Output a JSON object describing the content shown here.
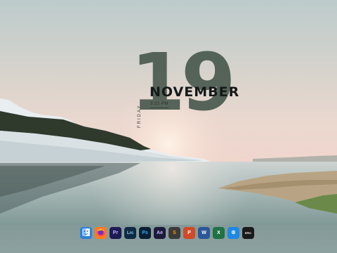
{
  "clock": {
    "day": "19",
    "month": "NOVEMBER",
    "time": "3:22 PM",
    "weekday": "FRIDAY"
  },
  "dock": {
    "apps": [
      {
        "name": "finder",
        "icon": "finder-icon",
        "glyph": "",
        "bg": "#2f7fd8",
        "fg": "#ffffff"
      },
      {
        "name": "firefox",
        "icon": "firefox-icon",
        "glyph": "",
        "bg": "#ff7a1a",
        "fg": "#ffffff"
      },
      {
        "name": "premiere-pro",
        "icon": "premiere-icon",
        "glyph": "Pr",
        "bg": "#1d1b55",
        "fg": "#c5b3ff"
      },
      {
        "name": "lightroom-classic",
        "icon": "lightroom-icon",
        "glyph": "Lrc",
        "bg": "#0f2a44",
        "fg": "#8fd3ff"
      },
      {
        "name": "photoshop",
        "icon": "photoshop-icon",
        "glyph": "Ps",
        "bg": "#0a1f33",
        "fg": "#31a8ff"
      },
      {
        "name": "after-effects",
        "icon": "after-effects-icon",
        "glyph": "Ae",
        "bg": "#1d1b3a",
        "fg": "#c7b6ff"
      },
      {
        "name": "sublime-text",
        "icon": "sublime-icon",
        "glyph": "S",
        "bg": "#3b3b3b",
        "fg": "#ff9800"
      },
      {
        "name": "powerpoint",
        "icon": "powerpoint-icon",
        "glyph": "P",
        "bg": "#d04a27",
        "fg": "#ffffff"
      },
      {
        "name": "word",
        "icon": "word-icon",
        "glyph": "W",
        "bg": "#2b5797",
        "fg": "#ffffff"
      },
      {
        "name": "excel",
        "icon": "excel-icon",
        "glyph": "X",
        "bg": "#1f7244",
        "fg": "#ffffff"
      },
      {
        "name": "settings",
        "icon": "gear-icon",
        "glyph": "⚙",
        "bg": "#1e88e5",
        "fg": "#ffffff"
      },
      {
        "name": "epic-games",
        "icon": "epic-games-icon",
        "glyph": "EPIC",
        "bg": "#1a1a1a",
        "fg": "#ffffff"
      }
    ]
  }
}
